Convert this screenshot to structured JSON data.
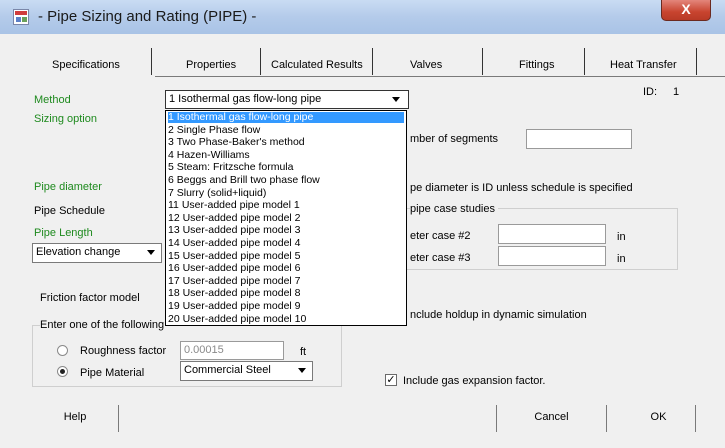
{
  "window": {
    "title": "- Pipe Sizing and Rating (PIPE)  -",
    "close_glyph": "X"
  },
  "tabs": [
    "Specifications",
    "Properties",
    "Calculated Results",
    "Valves",
    "Fittings",
    "Heat Transfer"
  ],
  "id_label": "ID:",
  "id_value": "1",
  "labels": {
    "method": "Method",
    "sizing_option": "Sizing option",
    "pipe_diameter": "Pipe diameter",
    "pipe_schedule": "Pipe Schedule",
    "pipe_length": "Pipe Length",
    "friction_factor_model": "Friction factor model",
    "number_of_segments": "mber of segments",
    "diameter_note": "pe diameter is ID unless schedule is specified",
    "case_studies_group": "pipe case studies",
    "case2": "eter case #2",
    "case3": "eter case #3",
    "unit_in_1": "in",
    "unit_in_2": "in",
    "holdup": "nclude holdup in dynamic simulation",
    "enter_one": "Enter one of the following",
    "roughness_factor": "Roughness factor",
    "roughness_unit": "ft",
    "pipe_material": "Pipe Material",
    "gas_expansion": "Include gas expansion factor."
  },
  "method_combo": {
    "value": "1 Isothermal gas flow-long pipe"
  },
  "elevation_combo": {
    "value": "Elevation change"
  },
  "material_combo": {
    "value": "Commercial Steel"
  },
  "roughness_input": {
    "value": "0.00015"
  },
  "method_options": [
    "1 Isothermal gas flow-long pipe",
    "2 Single Phase flow",
    "3 Two Phase-Baker's method",
    "4 Hazen-Williams",
    "5 Steam: Fritzsche formula",
    "6 Beggs and Brill two phase flow",
    "7 Slurry (solid+liquid)",
    "11 User-added pipe model 1",
    "12 User-added pipe model 2",
    "13 User-added pipe model 3",
    "14 User-added pipe model 4",
    "15 User-added pipe model 5",
    "16 User-added pipe model 6",
    "17 User-added pipe model 7",
    "18 User-added pipe model 8",
    "19 User-added pipe model 9",
    "20 User-added pipe model 10"
  ],
  "roughness_selected": false,
  "material_selected": true,
  "gas_expansion_checked": true,
  "buttons": {
    "help": "Help",
    "cancel": "Cancel",
    "ok": "OK"
  },
  "colors": {
    "green_label": "#1e8a1e",
    "selection": "#3399ff",
    "close_button": "#c8442f"
  }
}
